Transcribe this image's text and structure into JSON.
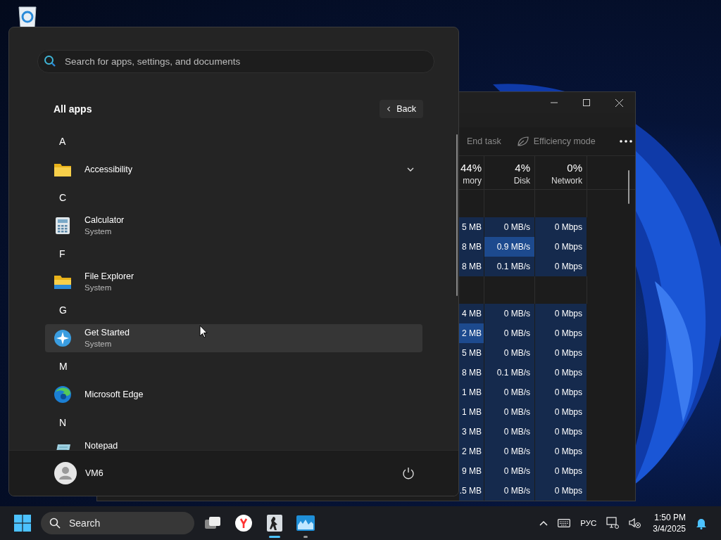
{
  "task_manager": {
    "toolbar": [
      {
        "label": "End task",
        "disabled": true
      },
      {
        "label": "Efficiency mode",
        "disabled": true
      }
    ],
    "columns": [
      {
        "value": "44%",
        "label": "mory"
      },
      {
        "value": "4%",
        "label": "Disk"
      },
      {
        "value": "0%",
        "label": "Network"
      }
    ],
    "rows": [
      {
        "kind": "group"
      },
      {
        "kind": "process",
        "cells": [
          {
            "text": "5 MB",
            "highlight": false
          },
          {
            "text": "0 MB/s",
            "highlight": false
          },
          {
            "text": "0 Mbps",
            "highlight": false
          }
        ]
      },
      {
        "kind": "process",
        "cells": [
          {
            "text": "8 MB",
            "highlight": false
          },
          {
            "text": "0.9 MB/s",
            "highlight": true
          },
          {
            "text": "0 Mbps",
            "highlight": false
          }
        ]
      },
      {
        "kind": "process",
        "cells": [
          {
            "text": "8 MB",
            "highlight": false
          },
          {
            "text": "0.1 MB/s",
            "highlight": false
          },
          {
            "text": "0 Mbps",
            "highlight": false
          }
        ]
      },
      {
        "kind": "group"
      },
      {
        "kind": "process",
        "cells": [
          {
            "text": "4 MB",
            "highlight": false
          },
          {
            "text": "0 MB/s",
            "highlight": false
          },
          {
            "text": "0 Mbps",
            "highlight": false
          }
        ]
      },
      {
        "kind": "process",
        "cells": [
          {
            "text": "2 MB",
            "highlight": true
          },
          {
            "text": "0 MB/s",
            "highlight": false
          },
          {
            "text": "0 Mbps",
            "highlight": false
          }
        ]
      },
      {
        "kind": "process",
        "cells": [
          {
            "text": "5 MB",
            "highlight": false
          },
          {
            "text": "0 MB/s",
            "highlight": false
          },
          {
            "text": "0 Mbps",
            "highlight": false
          }
        ]
      },
      {
        "kind": "process",
        "cells": [
          {
            "text": "8 MB",
            "highlight": false
          },
          {
            "text": "0.1 MB/s",
            "highlight": false
          },
          {
            "text": "0 Mbps",
            "highlight": false
          }
        ]
      },
      {
        "kind": "process",
        "cells": [
          {
            "text": "1 MB",
            "highlight": false
          },
          {
            "text": "0 MB/s",
            "highlight": false
          },
          {
            "text": "0 Mbps",
            "highlight": false
          }
        ]
      },
      {
        "kind": "process",
        "cells": [
          {
            "text": "1 MB",
            "highlight": false
          },
          {
            "text": "0 MB/s",
            "highlight": false
          },
          {
            "text": "0 Mbps",
            "highlight": false
          }
        ]
      },
      {
        "kind": "process",
        "cells": [
          {
            "text": "3 MB",
            "highlight": false
          },
          {
            "text": "0 MB/s",
            "highlight": false
          },
          {
            "text": "0 Mbps",
            "highlight": false
          }
        ]
      },
      {
        "kind": "process",
        "cells": [
          {
            "text": "2 MB",
            "highlight": false
          },
          {
            "text": "0 MB/s",
            "highlight": false
          },
          {
            "text": "0 Mbps",
            "highlight": false
          }
        ]
      },
      {
        "kind": "process",
        "cells": [
          {
            "text": "9 MB",
            "highlight": false
          },
          {
            "text": "0 MB/s",
            "highlight": false
          },
          {
            "text": "0 Mbps",
            "highlight": false
          }
        ]
      },
      {
        "kind": "process",
        "cells": [
          {
            "text": ".5 MB",
            "highlight": false
          },
          {
            "text": "0 MB/s",
            "highlight": false
          },
          {
            "text": "0 Mbps",
            "highlight": false
          }
        ]
      }
    ]
  },
  "start_menu": {
    "search": {
      "placeholder": "Search for apps, settings, and documents"
    },
    "title": "All apps",
    "back_button": "Back",
    "items": [
      {
        "kind": "letter",
        "text": "A"
      },
      {
        "kind": "folder",
        "name": "Accessibility",
        "hovered": false
      },
      {
        "kind": "letter",
        "text": "C"
      },
      {
        "kind": "calculator",
        "name": "Calculator",
        "subtitle": "System",
        "hovered": false
      },
      {
        "kind": "letter",
        "text": "F"
      },
      {
        "kind": "explorer",
        "name": "File Explorer",
        "subtitle": "System",
        "hovered": false
      },
      {
        "kind": "letter",
        "text": "G"
      },
      {
        "kind": "getstarted",
        "name": "Get Started",
        "subtitle": "System",
        "hovered": true
      },
      {
        "kind": "letter",
        "text": "M"
      },
      {
        "kind": "edge",
        "name": "Microsoft Edge",
        "hovered": false
      },
      {
        "kind": "letter",
        "text": "N"
      },
      {
        "kind": "notepad",
        "name": "Notepad",
        "hovered": false
      }
    ],
    "user": {
      "name": "VM6"
    }
  },
  "taskbar": {
    "search": "Search",
    "apps": [
      {
        "kind": "taskview",
        "running": false,
        "selected": false
      },
      {
        "kind": "yandex",
        "running": false,
        "selected": false
      },
      {
        "kind": "game",
        "running": true,
        "selected": true
      },
      {
        "kind": "monitor",
        "running": true,
        "selected": false
      }
    ],
    "tray": {
      "language": "РУС",
      "time": "1:50 PM",
      "date": "3/4/2025"
    }
  }
}
